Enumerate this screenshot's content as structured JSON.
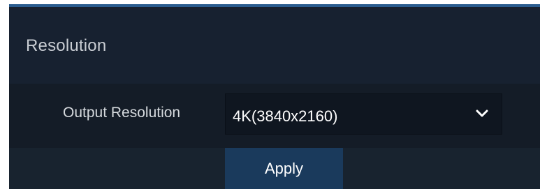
{
  "section": {
    "title": "Resolution"
  },
  "output_resolution": {
    "label": "Output Resolution",
    "selected": "4K(3840x2160)",
    "chevron_icon": "chevron-down-icon"
  },
  "actions": {
    "apply_label": "Apply"
  },
  "colors": {
    "panel_bg": "#141c27",
    "header_bg": "#172130",
    "accent_line": "#2a5c8f",
    "button_bg": "#1a3a5c"
  }
}
